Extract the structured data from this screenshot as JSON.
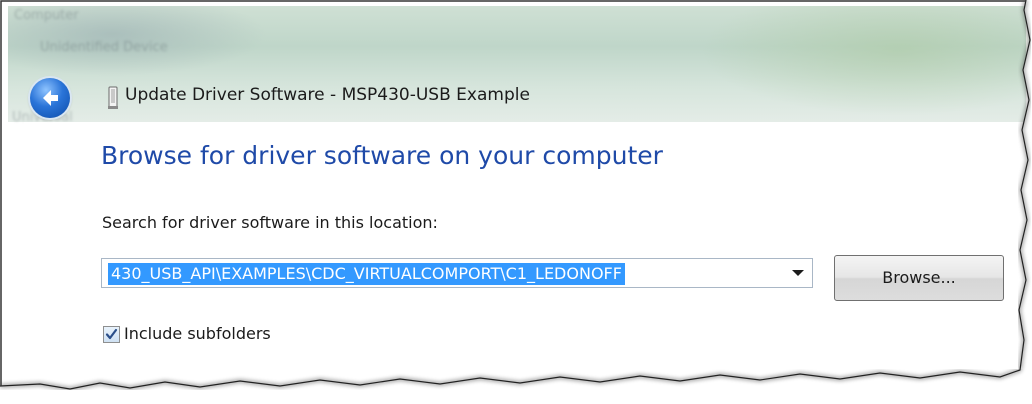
{
  "window": {
    "title": "Update Driver Software - MSP430-USB Example"
  },
  "background_ghost_text": [
    "Computer",
    "Unidentified Device",
    "Universal"
  ],
  "page": {
    "heading": "Browse for driver software on your computer",
    "search_label": "Search for driver software in this location:",
    "path_value": "430_USB_API\\EXAMPLES\\CDC_VIRTUALCOMPORT\\C1_LEDONOFF",
    "browse_label": "Browse...",
    "include_subfolders_label": "Include subfolders",
    "include_subfolders_checked": true
  },
  "icons": {
    "back": "back-arrow-icon",
    "device": "usb-device-icon",
    "dropdown": "chevron-down-icon",
    "check": "checkmark-icon"
  },
  "colors": {
    "heading": "#1f4aa8",
    "selection": "#3399ff",
    "back_button": "#2a74d8"
  }
}
